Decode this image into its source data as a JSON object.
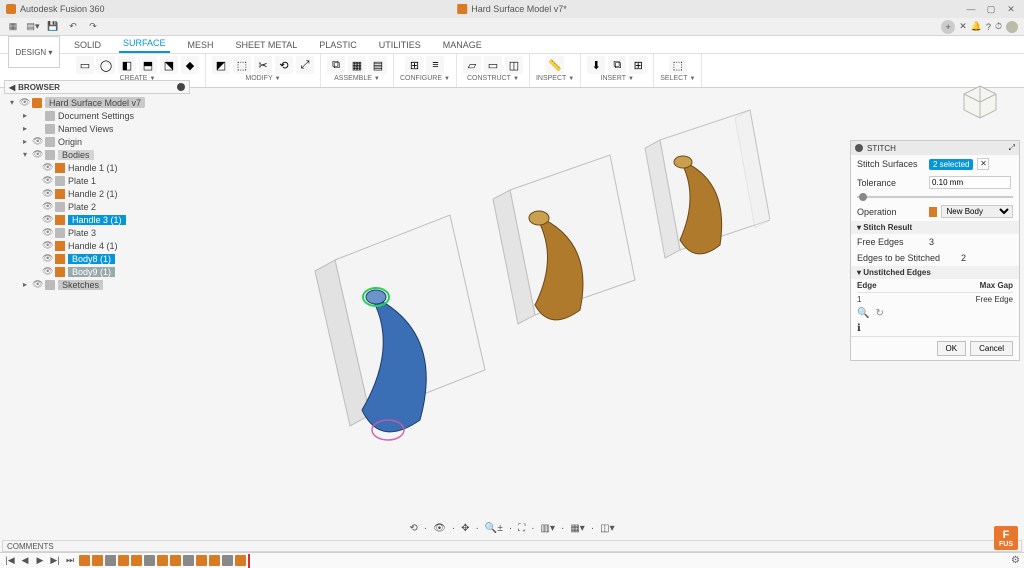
{
  "app": {
    "name": "Autodesk Fusion 360",
    "document": "Hard Surface Model v7*"
  },
  "workspace": "DESIGN ▾",
  "ribbon_tabs": [
    "SOLID",
    "SURFACE",
    "MESH",
    "SHEET METAL",
    "PLASTIC",
    "UTILITIES",
    "MANAGE"
  ],
  "ribbon_active": "SURFACE",
  "ribbon_groups": [
    {
      "name": "CREATE",
      "dropdown": true,
      "icons": [
        "▭",
        "◯",
        "◧",
        "⬒",
        "⬔",
        "◆"
      ]
    },
    {
      "name": "MODIFY",
      "dropdown": true,
      "icons": [
        "◩",
        "⬚",
        "✂",
        "⟲",
        "⤢"
      ]
    },
    {
      "name": "ASSEMBLE",
      "dropdown": true,
      "icons": [
        "⧉",
        "▦",
        "▤"
      ]
    },
    {
      "name": "CONFIGURE",
      "dropdown": true,
      "icons": [
        "⊞",
        "≡"
      ]
    },
    {
      "name": "CONSTRUCT",
      "dropdown": true,
      "icons": [
        "▱",
        "▭",
        "◫"
      ]
    },
    {
      "name": "INSPECT",
      "dropdown": true,
      "icons": [
        "📏"
      ]
    },
    {
      "name": "INSERT",
      "dropdown": true,
      "icons": [
        "⬇",
        "⧉",
        "⊞"
      ]
    },
    {
      "name": "SELECT",
      "dropdown": true,
      "icons": [
        "⬚"
      ]
    }
  ],
  "browser": {
    "title": "BROWSER",
    "root": "Hard Surface Model v7",
    "nodes": [
      {
        "depth": 1,
        "label": "Document Settings",
        "arrow": "▸",
        "eye": false,
        "icon": "gray"
      },
      {
        "depth": 1,
        "label": "Named Views",
        "arrow": "▸",
        "eye": false,
        "icon": "gray"
      },
      {
        "depth": 1,
        "label": "Origin",
        "arrow": "▸",
        "eye": true,
        "icon": "gray"
      },
      {
        "depth": 1,
        "label": "Bodies",
        "arrow": "▾",
        "eye": true,
        "icon": "gray",
        "bodies_header": true
      },
      {
        "depth": 2,
        "label": "Handle 1 (1)",
        "eye": true,
        "icon": "orange"
      },
      {
        "depth": 2,
        "label": "Plate 1",
        "eye": true,
        "icon": "gray"
      },
      {
        "depth": 2,
        "label": "Handle 2 (1)",
        "eye": true,
        "icon": "orange"
      },
      {
        "depth": 2,
        "label": "Plate 2",
        "eye": true,
        "icon": "gray"
      },
      {
        "depth": 2,
        "label": "Handle 3 (1)",
        "eye": true,
        "icon": "orange",
        "selected": true
      },
      {
        "depth": 2,
        "label": "Plate 3",
        "eye": true,
        "icon": "gray"
      },
      {
        "depth": 2,
        "label": "Handle 4 (1)",
        "eye": true,
        "icon": "orange"
      },
      {
        "depth": 2,
        "label": "Body8 (1)",
        "eye": true,
        "icon": "orange",
        "selected": true
      },
      {
        "depth": 2,
        "label": "Body9 (1)",
        "eye": true,
        "icon": "orange",
        "hover": true
      },
      {
        "depth": 1,
        "label": "Sketches",
        "arrow": "▸",
        "eye": true,
        "icon": "gray",
        "sketch": true
      }
    ]
  },
  "stitch": {
    "title": "STITCH",
    "surfaces_label": "Stitch Surfaces",
    "surfaces_badge": "2 selected",
    "tolerance_label": "Tolerance",
    "tolerance_value": "0.10 mm",
    "operation_label": "Operation",
    "operation_value": "New Body",
    "section_result": "Stitch Result",
    "free_edges_label": "Free Edges",
    "free_edges_value": "3",
    "to_stitch_label": "Edges to be Stitched",
    "to_stitch_value": "2",
    "section_unstitched": "Unstitched Edges",
    "col_edge": "Edge",
    "col_gap": "Max Gap",
    "row_edge": "1",
    "row_gap": "Free Edge",
    "ok": "OK",
    "cancel": "Cancel"
  },
  "comments": {
    "label": "COMMENTS"
  },
  "timeline_features": 13,
  "fus": {
    "top": "F",
    "bottom": "FUS"
  }
}
